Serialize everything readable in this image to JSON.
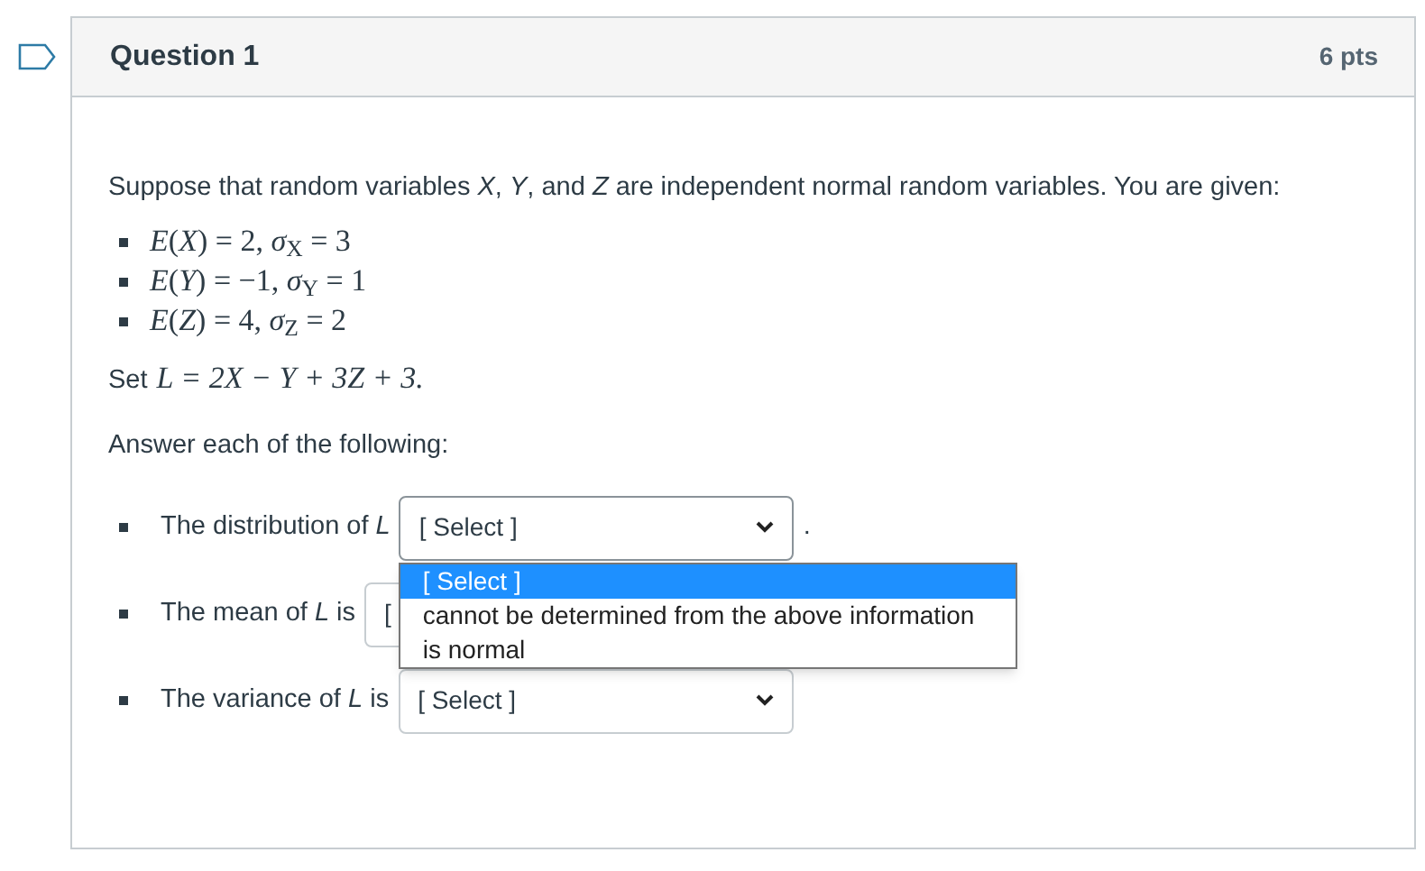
{
  "question": {
    "title": "Question 1",
    "points": "6 pts",
    "flagged": false
  },
  "intro": "Suppose that random variables *X*, *Y*, and *Z* are independent normal random variables. You are given:",
  "givens": [
    "*E*(*X*) = 2, *σ*$_{X}$ = 3",
    "*E*(*Y*) = −1, *σ*$_{Y}$ = 1",
    "*E*(*Z*) = 4, *σ*$_{Z}$ = 2"
  ],
  "definition": {
    "label": "Set",
    "formula": "L = 2X − Y + 3Z + 3."
  },
  "instruction": "Answer each of the following:",
  "answers": [
    {
      "text": "The distribution of *L*",
      "value": "[ Select ]",
      "after": ".",
      "open": true,
      "options": [
        {
          "label": "[ Select ]",
          "selected": true
        },
        {
          "label": "cannot be determined from the above information",
          "selected": false
        },
        {
          "label": "is normal",
          "selected": false
        }
      ]
    },
    {
      "text": "The mean of *L* is",
      "value": "[",
      "open": false
    },
    {
      "text": "The variance of *L* is",
      "value": "[ Select ]",
      "open": false
    }
  ]
}
